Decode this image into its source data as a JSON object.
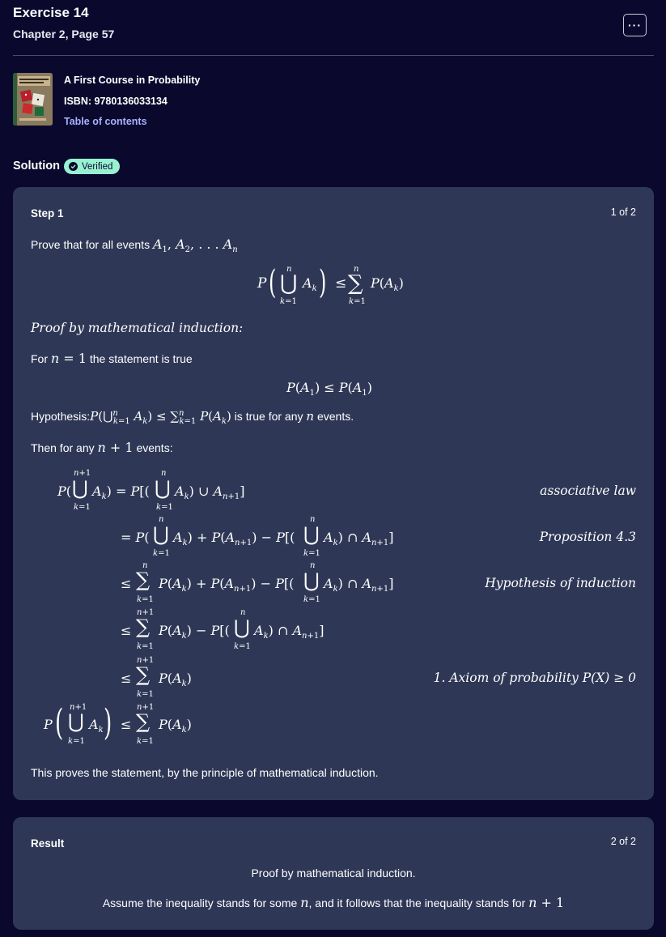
{
  "header": {
    "title": "Exercise 14",
    "subtitle": "Chapter 2, Page 57",
    "more_label": "···"
  },
  "book": {
    "title": "A First Course in Probability",
    "isbn": "ISBN: 9780136033134",
    "toc_link": "Table of contents",
    "cover_text": "A First Course in PROBABILITY"
  },
  "solution": {
    "label": "Solution",
    "badge": "Verified"
  },
  "step1": {
    "label": "Step 1",
    "counter": "1 of 2",
    "prove_text": "Prove that for all events",
    "proof_heading": "Proof by mathematical induction:",
    "for_text": "For",
    "for_text_tail": "the statement is true",
    "hyp_prefix": "Hypothesis:",
    "hyp_suffix": "is true for any",
    "hyp_suffix2": "events.",
    "then_text": "Then for any",
    "then_tail": "events:",
    "just": {
      "associative": "associative law",
      "proposition": "Proposition 4.3",
      "hypothesis": "Hypothesis of induction",
      "axiom": "1. Axiom of probability P(X) ≥ 0"
    },
    "conclusion": "This proves the statement, by the principle of mathematical induction."
  },
  "result": {
    "label": "Result",
    "counter": "2 of 2",
    "line1": "Proof by mathematical induction.",
    "line2_prefix": "Assume the inequality stands for some",
    "line2_mid": ", and it follows that the inequality stands for"
  },
  "colors": {
    "background": "#0a092d",
    "card": "#2e3856",
    "link": "#a8b1ff",
    "badge": "#98f1d1"
  }
}
